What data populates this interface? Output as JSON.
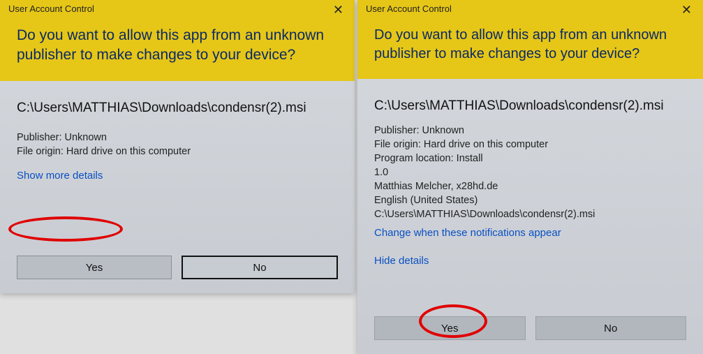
{
  "left": {
    "title": "User Account Control",
    "question": "Do you want to allow this app from an unknown publisher to make changes to your device?",
    "filepath": "C:\\Users\\MATTHIAS\\Downloads\\condensr(2).msi",
    "publisher_line": "Publisher: Unknown",
    "origin_line": "File origin: Hard drive on this computer",
    "show_more": "Show more details",
    "yes": "Yes",
    "no": "No"
  },
  "right": {
    "title": "User Account Control",
    "question": "Do you want to allow this app from an unknown publisher to make changes to your device?",
    "filepath": "C:\\Users\\MATTHIAS\\Downloads\\condensr(2).msi",
    "publisher_line": "Publisher: Unknown",
    "origin_line": "File origin: Hard drive on this computer",
    "program_location_line": "Program location: Install",
    "version_line": "1.0",
    "author_line": "Matthias Melcher, x28hd.de",
    "language_line": "English (United States)",
    "path_line": "C:\\Users\\MATTHIAS\\Downloads\\condensr(2).msi",
    "change_link": "Change when these notifications appear",
    "hide_link": "Hide details",
    "yes": "Yes",
    "no": "No"
  }
}
